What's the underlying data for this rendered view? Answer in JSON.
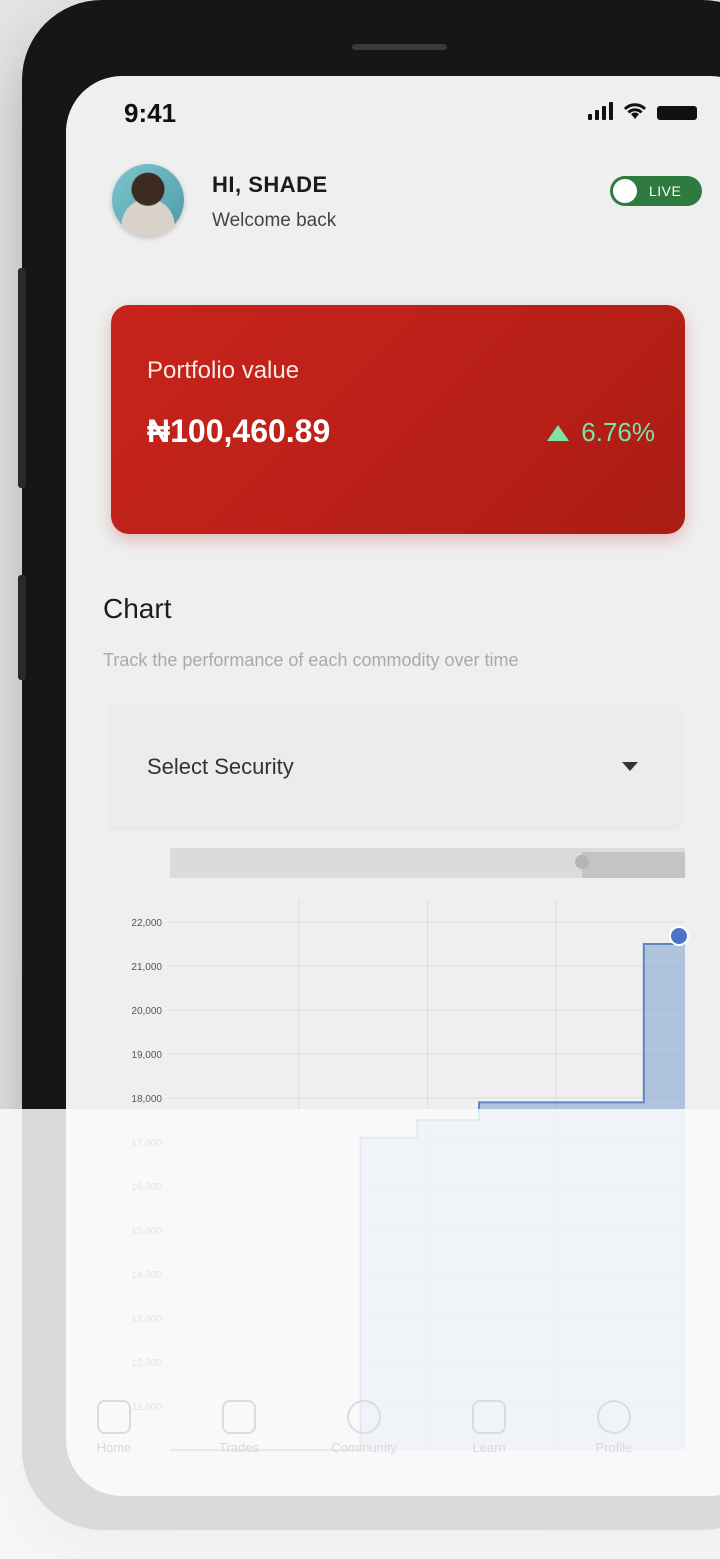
{
  "status_bar": {
    "time": "9:41"
  },
  "header": {
    "greeting": "HI, SHADE",
    "subtitle": "Welcome back",
    "live_toggle_label": "LIVE"
  },
  "portfolio": {
    "label": "Portfolio value",
    "value": "₦100,460.89",
    "change": "6.76%",
    "card_color": "#c8241b",
    "change_color": "#7ee2a3"
  },
  "chart_section": {
    "title": "Chart",
    "subtitle": "Track the performance of each commodity over time",
    "select_label": "Select Security"
  },
  "chart_data": {
    "type": "area",
    "title": "",
    "xlabel": "",
    "ylabel": "",
    "ylim": [
      10000,
      22500
    ],
    "y_ticks": [
      "22,000",
      "21,000",
      "20,000",
      "19,000",
      "18,000",
      "17,000",
      "16,000",
      "15,000",
      "14,000",
      "13,000",
      "12,000",
      "11,000"
    ],
    "y_tick_values": [
      22000,
      21000,
      20000,
      19000,
      18000,
      17000,
      16000,
      15000,
      14000,
      13000,
      12000,
      11000
    ],
    "x": [
      0,
      0.37,
      0.37,
      0.48,
      0.48,
      0.6,
      0.6,
      0.92,
      0.92,
      0.98,
      0.98,
      1.0
    ],
    "values": [
      10000,
      10000,
      17100,
      17100,
      17500,
      17500,
      17900,
      17900,
      21500,
      21500,
      21500,
      21500
    ],
    "series_color": "#7b9fcf",
    "grid": true
  },
  "bottom_nav": {
    "items": [
      {
        "label": "Home",
        "icon": "home-icon"
      },
      {
        "label": "Trades",
        "icon": "swap-icon"
      },
      {
        "label": "Community",
        "icon": "people-icon"
      },
      {
        "label": "Learn",
        "icon": "book-icon"
      },
      {
        "label": "Profile",
        "icon": "profile-icon"
      }
    ]
  }
}
